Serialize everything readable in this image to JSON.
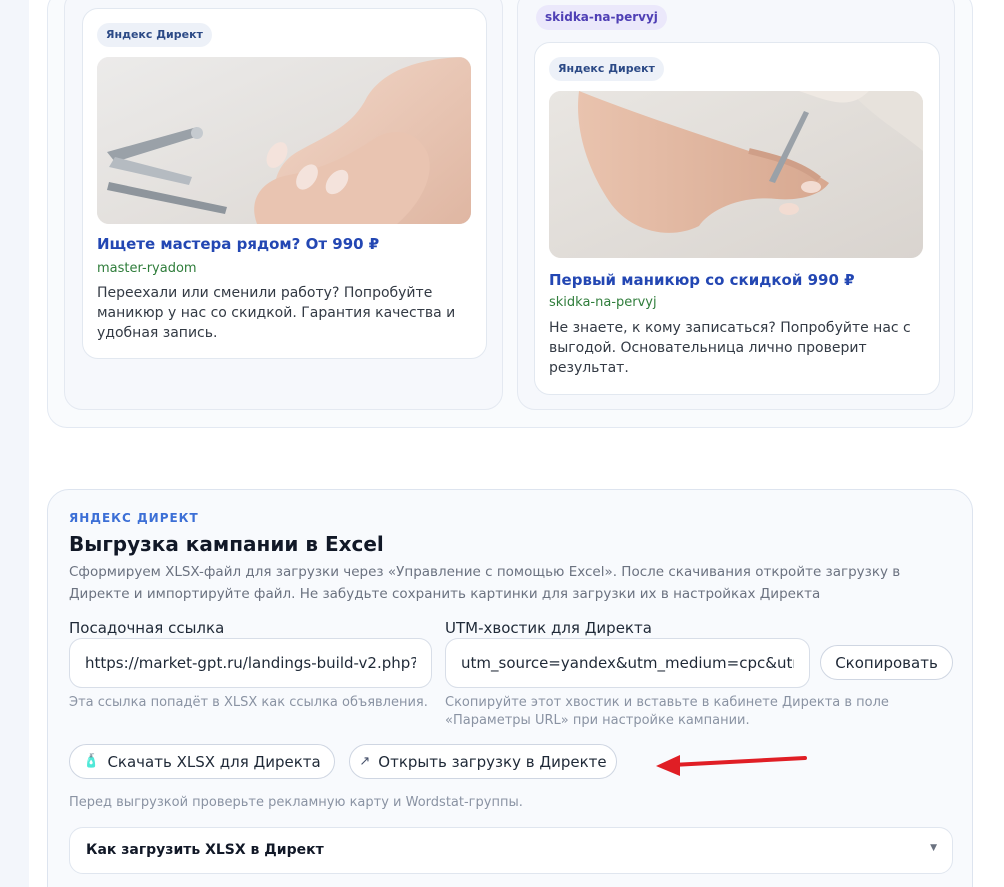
{
  "ads": [
    {
      "source": "Яндекс Директ",
      "title": "Ищете мастера рядом? От 990 ₽",
      "display_url": "master-ryadom",
      "text": "Переехали или сменили работу? Попробуйте маникюр у нас со скидкой. Гарантия качества и удобная запись.",
      "image": "hands-with-cuticle-nippers"
    },
    {
      "group": "skidka-na-pervyj",
      "source": "Яндекс Директ",
      "title": "Первый маникюр со скидкой 990 ₽",
      "display_url": "skidka-na-pervyj",
      "text": "Не знаете, к кому записаться? Попробуйте нас с выгодой. Основательница лично проверит результат.",
      "image": "hand-manicure-pusher"
    }
  ],
  "export": {
    "eyebrow": "ЯНДЕКС ДИРЕКТ",
    "title": "Выгрузка кампании в Excel",
    "description": "Сформируем XLSX-файл для загрузки через «Управление с помощью Excel». После скачивания откройте загрузку в Директе и импортируйте файл. Не забудьте сохранить картинки для загрузки их в настройках Директа",
    "landing_label": "Посадочная ссылка",
    "landing_value": "https://market-gpt.ru/landings-build-v2.php?",
    "landing_hint": "Эта ссылка попадёт в XLSX как ссылка объявления.",
    "utm_label": "UTM-хвостик для Директа",
    "utm_value": "utm_source=yandex&utm_medium=cpc&utm",
    "utm_hint": "Скопируйте этот хвостик и вставьте в кабинете Директа в поле «Параметры URL» при настройке кампании.",
    "copy_button": "Скопировать",
    "download_button": "Скачать XLSX для Директа",
    "download_icon": "🧴",
    "open_button": "Открыть загрузку в Директе",
    "open_icon": "↗",
    "pre_note": "Перед выгрузкой проверьте рекламную карту и Wordstat-группы.",
    "accordion_title": "Как загрузить XLSX в Директ",
    "accordion_caret": "▼"
  },
  "colors": {
    "accent": "#2347b3",
    "url_green": "#2f7d3b",
    "eyebrow_blue": "#3c6fd6",
    "annotation_arrow": "#e01e25"
  }
}
